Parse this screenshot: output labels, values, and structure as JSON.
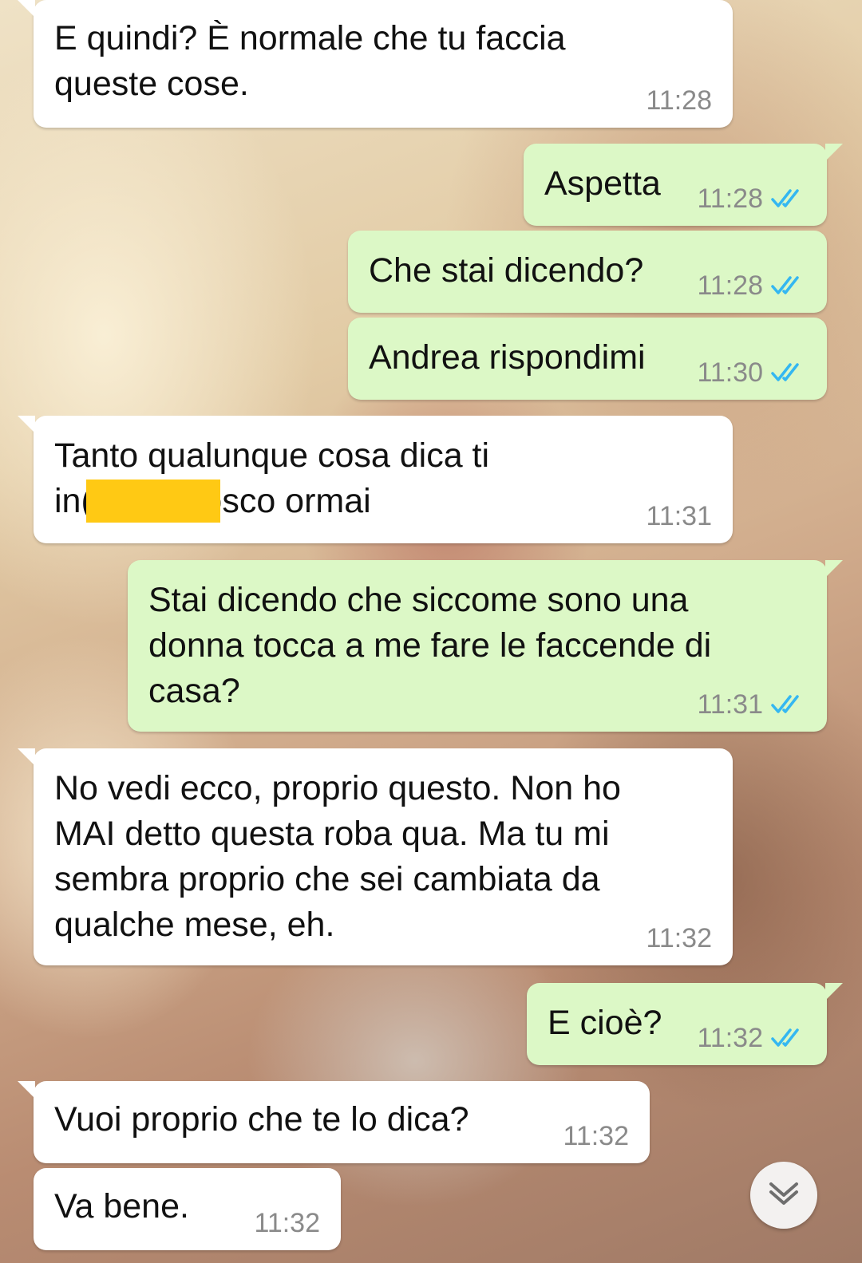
{
  "messages": [
    {
      "text": "E quindi? È normale che tu faccia\nqueste cose.",
      "time": "11:28"
    },
    {
      "text": "Aspetta",
      "time": "11:28",
      "status": "read"
    },
    {
      "text": "Che stai dicendo?",
      "time": "11:28",
      "status": "read"
    },
    {
      "text": "Andrea rispondimi",
      "time": "11:30",
      "status": "read"
    },
    {
      "text": "Tanto qualunque cosa dica ti\nin(          , ti conosco ormai",
      "time": "11:31"
    },
    {
      "text": "Stai dicendo che siccome sono una\ndonna tocca a me fare le faccende di\ncasa?",
      "time": "11:31",
      "status": "read"
    },
    {
      "text": "No vedi ecco, proprio questo. Non ho\nMAI detto questa roba qua. Ma tu mi\nsembra proprio che sei cambiata da\nqualche mese, eh.",
      "time": "11:32"
    },
    {
      "text": "E cioè?",
      "time": "11:32",
      "status": "read"
    },
    {
      "text": "Vuoi proprio che te lo dica?",
      "time": "11:32"
    },
    {
      "text": "Va bene.",
      "time": "11:32"
    }
  ],
  "colors": {
    "incoming_bubble": "#ffffff",
    "outgoing_bubble": "#dcf8c6",
    "read_ticks": "#34b7f1",
    "timestamp": "#8a8a8a",
    "redaction": "#ffc914"
  },
  "icons": {
    "read_receipt": "double-check-icon",
    "scroll_down": "double-chevron-down-icon"
  }
}
